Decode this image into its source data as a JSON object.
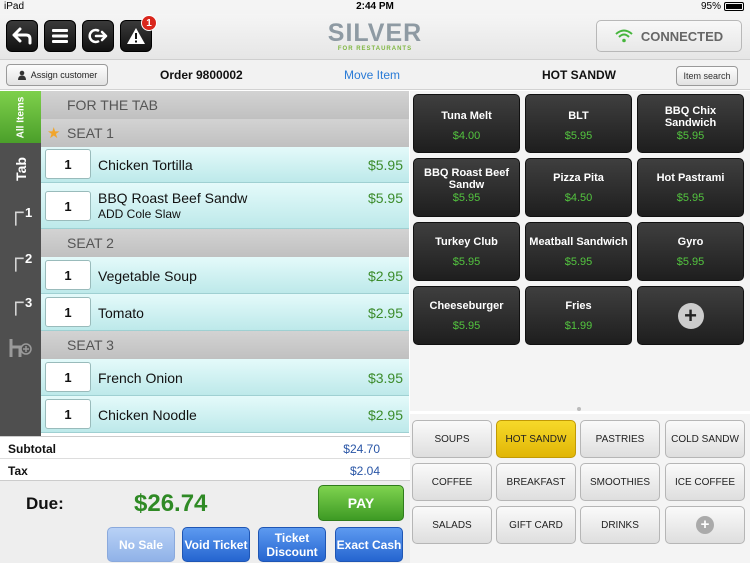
{
  "status_bar": {
    "carrier": "iPad",
    "time": "2:44 PM",
    "battery": "95%"
  },
  "toolbar": {
    "alert_count": "1",
    "logo_text": "SILVER",
    "logo_sub": "FOR RESTAURANTS",
    "connection_status": "CONNECTED"
  },
  "order_bar": {
    "assign_customer": "Assign customer",
    "order_number": "Order 9800002",
    "move_item": "Move Item",
    "category_title": "HOT SANDW",
    "item_search": "Item search"
  },
  "sidebar": {
    "all_items": "All Items",
    "tab": "Tab",
    "seats": [
      "1",
      "2",
      "3"
    ]
  },
  "order": {
    "tab_section": "FOR THE TAB",
    "seats": [
      {
        "label": "SEAT 1",
        "items": [
          {
            "qty": "1",
            "name": "Chicken Tortilla",
            "modifier": "",
            "price": "$5.95"
          },
          {
            "qty": "1",
            "name": "BBQ Roast Beef Sandw",
            "modifier": "ADD Cole Slaw",
            "price": "$5.95"
          }
        ]
      },
      {
        "label": "SEAT 2",
        "items": [
          {
            "qty": "1",
            "name": "Vegetable Soup",
            "modifier": "",
            "price": "$2.95"
          },
          {
            "qty": "1",
            "name": "Tomato",
            "modifier": "",
            "price": "$2.95"
          }
        ]
      },
      {
        "label": "SEAT 3",
        "items": [
          {
            "qty": "1",
            "name": "French Onion",
            "modifier": "",
            "price": "$3.95"
          },
          {
            "qty": "1",
            "name": "Chicken Noodle",
            "modifier": "",
            "price": "$2.95"
          }
        ]
      }
    ]
  },
  "totals": {
    "subtotal_label": "Subtotal",
    "subtotal": "$24.70",
    "tax_label": "Tax",
    "tax": "$2.04",
    "due_label": "Due:",
    "due": "$26.74"
  },
  "actions": {
    "pay": "PAY",
    "no_sale": "No Sale",
    "void_ticket": "Void Ticket",
    "ticket_discount": "Ticket Discount",
    "exact_cash": "Exact Cash"
  },
  "menu_items": [
    {
      "name": "Tuna Melt",
      "price": "$4.00"
    },
    {
      "name": "BLT",
      "price": "$5.95"
    },
    {
      "name": "BBQ Chix Sandwich",
      "price": "$5.95"
    },
    {
      "name": "BBQ Roast Beef Sandw",
      "price": "$5.95"
    },
    {
      "name": "Pizza Pita",
      "price": "$4.50"
    },
    {
      "name": "Hot Pastrami",
      "price": "$5.95"
    },
    {
      "name": "Turkey Club",
      "price": "$5.95"
    },
    {
      "name": "Meatball Sandwich",
      "price": "$5.95"
    },
    {
      "name": "Gyro",
      "price": "$5.95"
    },
    {
      "name": "Cheeseburger",
      "price": "$5.95"
    },
    {
      "name": "Fries",
      "price": "$1.99"
    }
  ],
  "categories": [
    {
      "label": "SOUPS",
      "active": false
    },
    {
      "label": "HOT SANDW",
      "active": true
    },
    {
      "label": "PASTRIES",
      "active": false
    },
    {
      "label": "COLD SANDW",
      "active": false
    },
    {
      "label": "COFFEE",
      "active": false
    },
    {
      "label": "BREAKFAST",
      "active": false
    },
    {
      "label": "SMOOTHIES",
      "active": false
    },
    {
      "label": "ICE COFFEE",
      "active": false
    },
    {
      "label": "SALADS",
      "active": false
    },
    {
      "label": "GIFT CARD",
      "active": false
    },
    {
      "label": "DRINKS",
      "active": false
    }
  ],
  "colors": {
    "accent_green": "#4b9f2a",
    "price_green": "#3c8c2c",
    "action_blue": "#2565d0",
    "active_category": "#e1b606"
  }
}
